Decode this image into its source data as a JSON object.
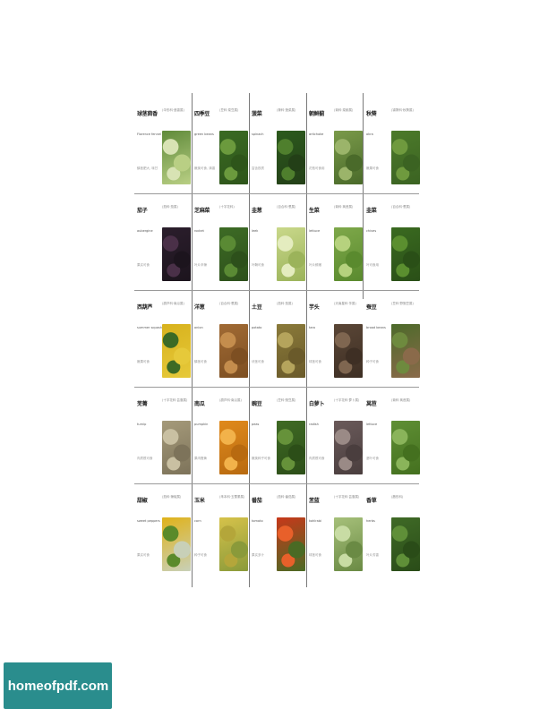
{
  "page": {
    "watermark_text": "homeofpdf.com",
    "watermark_color": "#2a8d8d"
  },
  "vegetables": [
    {
      "name": "球茎茴香",
      "note": "(伞形科·茴香属)",
      "latin": "Florence fennel",
      "desc": "鳞茎肥大, 味甘",
      "photo": "fennel-photo",
      "colors": [
        "#5f8a3a",
        "#d8e3b4",
        "#b9cf84"
      ]
    },
    {
      "name": "四季豆",
      "note": "(豆科·菜豆属)",
      "latin": "green beans",
      "desc": "嫩荚可食, 清香",
      "photo": "green-beans-photo",
      "colors": [
        "#3a6a23",
        "#6b9a3d",
        "#2e551a"
      ]
    },
    {
      "name": "菠菜",
      "note": "(藜科·菠菜属)",
      "latin": "spinach",
      "desc": "富含铁质",
      "photo": "spinach-photo",
      "colors": [
        "#2c5a1d",
        "#4f7f2d",
        "#233f17"
      ]
    },
    {
      "name": "朝鲜蓟",
      "note": "(菊科·菜蓟属)",
      "latin": "artichoke",
      "desc": "花苞可食用",
      "photo": "artichoke-photo",
      "colors": [
        "#7a9a4a",
        "#9bb46a",
        "#4a6a2a"
      ]
    },
    {
      "name": "秋葵",
      "note": "(锦葵科·秋葵属)",
      "latin": "okra",
      "desc": "嫩果可食",
      "photo": "okra-photo",
      "colors": [
        "#4c7a2a",
        "#6f9a3e",
        "#3b6322"
      ]
    },
    {
      "name": "茄子",
      "note": "(茄科·茄属)",
      "latin": "aubergine",
      "desc": "果实可食",
      "photo": "aubergine-photo",
      "colors": [
        "#2b1e2c",
        "#4a3048",
        "#1c141d"
      ]
    },
    {
      "name": "芝麻菜",
      "note": "(十字花科)",
      "latin": "rocket",
      "desc": "叶片辛辣",
      "photo": "rocket-photo",
      "colors": [
        "#3d6b25",
        "#5a8a34",
        "#2d501b"
      ]
    },
    {
      "name": "韭葱",
      "note": "(百合科·葱属)",
      "latin": "leek",
      "desc": "叶鞘可食",
      "photo": "leek-photo",
      "colors": [
        "#c9d88a",
        "#e4ecbf",
        "#9bb35a"
      ]
    },
    {
      "name": "生菜",
      "note": "(菊科·莴苣属)",
      "latin": "lettuce",
      "desc": "叶片鲜嫩",
      "photo": "lettuce-photo",
      "colors": [
        "#7ea84a",
        "#b6d27e",
        "#5a8a2e"
      ]
    },
    {
      "name": "韭菜",
      "note": "(百合科·葱属)",
      "latin": "chives",
      "desc": "叶可食用",
      "photo": "chives-photo",
      "colors": [
        "#3a6a20",
        "#5b8f2f",
        "#2a4f17"
      ]
    },
    {
      "name": "西葫芦",
      "note": "(葫芦科·南瓜属)",
      "latin": "summer squash",
      "desc": "嫩果可食",
      "photo": "squash-photo",
      "colors": [
        "#d8b21d",
        "#3c6a25",
        "#e6c93a"
      ]
    },
    {
      "name": "洋葱",
      "note": "(百合科·葱属)",
      "latin": "onion",
      "desc": "鳞茎可食",
      "photo": "onion-photo",
      "colors": [
        "#a06a34",
        "#c48d4d",
        "#7d4f22"
      ]
    },
    {
      "name": "土豆",
      "note": "(茄科·茄属)",
      "latin": "potato",
      "desc": "块茎可食",
      "photo": "potato-photo",
      "colors": [
        "#8a7a3a",
        "#b5a45c",
        "#6a5a2a"
      ]
    },
    {
      "name": "芋头",
      "note": "(天南星科·芋属)",
      "latin": "taro",
      "desc": "球茎可食",
      "photo": "taro-photo",
      "colors": [
        "#5a4636",
        "#7f6650",
        "#3e2f24"
      ]
    },
    {
      "name": "蚕豆",
      "note": "(豆科·野豌豆属)",
      "latin": "broad beans",
      "desc": "种子可食",
      "photo": "broad-beans-photo",
      "colors": [
        "#4c6a2a",
        "#6e8a3e",
        "#8a6a4a"
      ]
    },
    {
      "name": "芜菁",
      "note": "(十字花科·芸薹属)",
      "latin": "turnip",
      "desc": "肉质根可食",
      "photo": "turnip-photo",
      "colors": [
        "#a59a7a",
        "#c9c0a2",
        "#7d735a"
      ]
    },
    {
      "name": "南瓜",
      "note": "(葫芦科·南瓜属)",
      "latin": "pumpkin",
      "desc": "果肉橙黄",
      "photo": "pumpkin-photo",
      "colors": [
        "#e08a1c",
        "#f2b24a",
        "#b86a10"
      ]
    },
    {
      "name": "豌豆",
      "note": "(豆科·豌豆属)",
      "latin": "peas",
      "desc": "嫩荚种子可食",
      "photo": "peas-photo",
      "colors": [
        "#3f6a24",
        "#66923a",
        "#2c4e18"
      ]
    },
    {
      "name": "白萝卜",
      "note": "(十字花科·萝卜属)",
      "latin": "radish",
      "desc": "肉质根可食",
      "photo": "radish-photo",
      "colors": [
        "#6a5a5a",
        "#9a8a86",
        "#4a3e3e"
      ]
    },
    {
      "name": "莴苣",
      "note": "(菊科·莴苣属)",
      "latin": "lettuce",
      "desc": "茎叶可食",
      "photo": "romaine-photo",
      "colors": [
        "#5f8f34",
        "#8ab45a",
        "#44701f"
      ]
    },
    {
      "name": "甜椒",
      "note": "(茄科·辣椒属)",
      "latin": "sweet peppers",
      "desc": "果实可食",
      "photo": "peppers-photo",
      "colors": [
        "#e0b21a",
        "#5a8a2a",
        "#c8d0b8"
      ]
    },
    {
      "name": "玉米",
      "note": "(禾本科·玉蜀黍属)",
      "latin": "corn",
      "desc": "种子可食",
      "photo": "corn-photo",
      "colors": [
        "#d6c24a",
        "#b4a63a",
        "#8a9a3a"
      ]
    },
    {
      "name": "番茄",
      "note": "(茄科·番茄属)",
      "latin": "tomato",
      "desc": "果实多汁",
      "photo": "tomato-photo",
      "colors": [
        "#c8381a",
        "#e8602a",
        "#4a6a24"
      ]
    },
    {
      "name": "苤蓝",
      "note": "(十字花科·芸薹属)",
      "latin": "kohlrabi",
      "desc": "球茎可食",
      "photo": "kohlrabi-photo",
      "colors": [
        "#a6c07a",
        "#c8dca4",
        "#6a8a44"
      ]
    },
    {
      "name": "香草",
      "note": "(唇形科)",
      "latin": "herbs",
      "desc": "叶片芳香",
      "photo": "herbs-photo",
      "colors": [
        "#3f6a26",
        "#5f8f38",
        "#2a4c18"
      ]
    }
  ]
}
